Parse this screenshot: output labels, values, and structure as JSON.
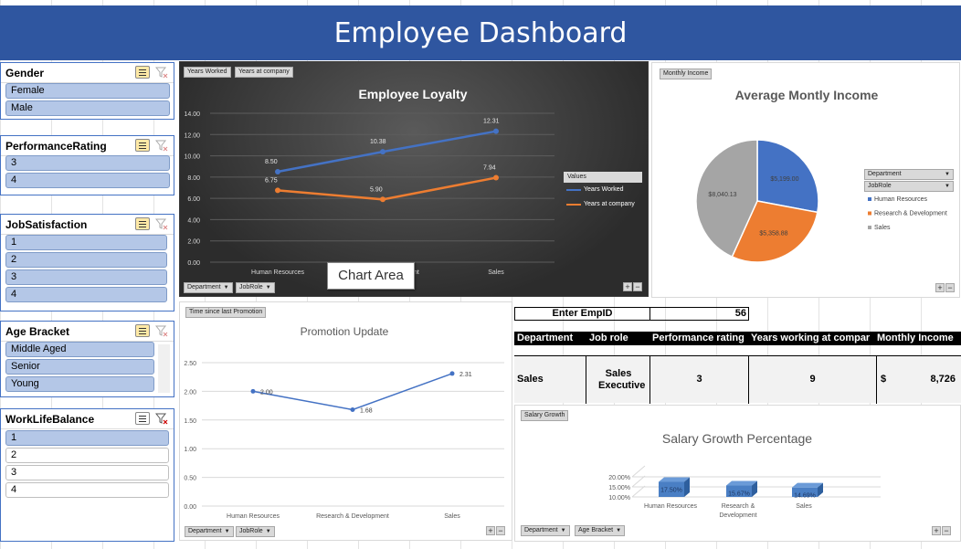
{
  "banner": {
    "title": "Employee Dashboard"
  },
  "slicers": [
    {
      "title": "Gender",
      "items": [
        "Female",
        "Male"
      ]
    },
    {
      "title": "PerformanceRating",
      "items": [
        "3",
        "4"
      ]
    },
    {
      "title": "JobSatisfaction",
      "items": [
        "1",
        "2",
        "3",
        "4"
      ]
    },
    {
      "title": "Age Bracket",
      "items": [
        "Middle Aged",
        "Senior",
        "Young"
      ]
    },
    {
      "title": "WorkLifeBalance",
      "items": [
        "1",
        "2",
        "3",
        "4"
      ]
    }
  ],
  "loyalty": {
    "fields": [
      "Years Worked",
      "Years at company"
    ],
    "axis_buttons": [
      "Department",
      "JobRole"
    ],
    "tooltip": "Chart Area",
    "legend_title": "Values"
  },
  "income": {
    "field": "Monthly Income",
    "filters": [
      "Department",
      "JobRole"
    ]
  },
  "promotion": {
    "field": "Time since last Promotion",
    "axis_buttons": [
      "Department",
      "JobRole"
    ]
  },
  "lookup": {
    "label": "Enter EmpID",
    "value": "56",
    "headers": [
      "Department",
      "Job role",
      "Performance rating",
      "Years working at compar",
      "Monthly Income"
    ],
    "row": {
      "department": "Sales",
      "job_role": "Sales Executive",
      "performance": "3",
      "years": "9",
      "currency": "$",
      "income": "8,726"
    }
  },
  "salary": {
    "field": "Salary Growth",
    "axis_buttons": [
      "Department",
      "Age Bracket"
    ]
  },
  "chart_data": [
    {
      "type": "line",
      "title": "Employee Loyalty",
      "categories": [
        "Human Resources",
        "Research & Development",
        "Sales"
      ],
      "series": [
        {
          "name": "Years Worked",
          "values": [
            8.5,
            10.38,
            12.31
          ],
          "color": "#4472c4"
        },
        {
          "name": "Years at company",
          "values": [
            6.75,
            5.9,
            7.94
          ],
          "color": "#ed7d31"
        }
      ],
      "ylim": [
        0,
        14
      ],
      "yticks": [
        "0.00",
        "2.00",
        "4.00",
        "6.00",
        "8.00",
        "10.00",
        "12.00",
        "14.00"
      ],
      "legend": "right",
      "grid": true
    },
    {
      "type": "pie",
      "title": "Average Montly Income",
      "categories": [
        "Human Resources",
        "Research & Development",
        "Sales"
      ],
      "values": [
        5199.0,
        5358.88,
        8040.13
      ],
      "labels": [
        "$5,199.00",
        "$5,358.88",
        "$8,040.13"
      ],
      "colors": [
        "#4472c4",
        "#ed7d31",
        "#a5a5a5"
      ],
      "legend": "right"
    },
    {
      "type": "line",
      "title": "Promotion Update",
      "categories": [
        "Human Resources",
        "Research & Development",
        "Sales"
      ],
      "series": [
        {
          "values": [
            2.0,
            1.68,
            2.31
          ],
          "color": "#4472c4"
        }
      ],
      "ylim": [
        0,
        2.5
      ],
      "yticks": [
        "0.00",
        "0.50",
        "1.00",
        "1.50",
        "2.00",
        "2.50"
      ],
      "grid": true
    },
    {
      "type": "bar",
      "title": "Salary Growth Percentage",
      "categories": [
        "Human Resources",
        "Research & Development",
        "Sales"
      ],
      "values": [
        17.5,
        15.67,
        14.69
      ],
      "labels": [
        "17.50%",
        "15.67%",
        "14.69%"
      ],
      "yticks": [
        "10.00%",
        "15.00%",
        "20.00%"
      ],
      "ylim": [
        10,
        20
      ]
    }
  ]
}
